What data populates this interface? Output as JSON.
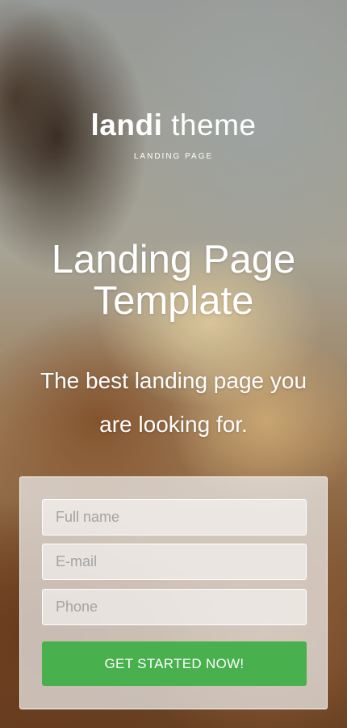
{
  "brand": {
    "name_bold": "landi",
    "name_light": "theme",
    "tagline": "LANDING PAGE"
  },
  "hero": {
    "headline_line1": "Landing Page",
    "headline_line2": "Template",
    "subheadline_line1": "The best landing page you",
    "subheadline_line2": "are looking for."
  },
  "form": {
    "full_name": {
      "placeholder": "Full name",
      "value": ""
    },
    "email": {
      "placeholder": "E-mail",
      "value": ""
    },
    "phone": {
      "placeholder": "Phone",
      "value": ""
    },
    "submit_label": "GET STARTED NOW!"
  },
  "colors": {
    "accent": "#48b04c",
    "text": "#ffffff",
    "placeholder": "#a3a3a3"
  }
}
